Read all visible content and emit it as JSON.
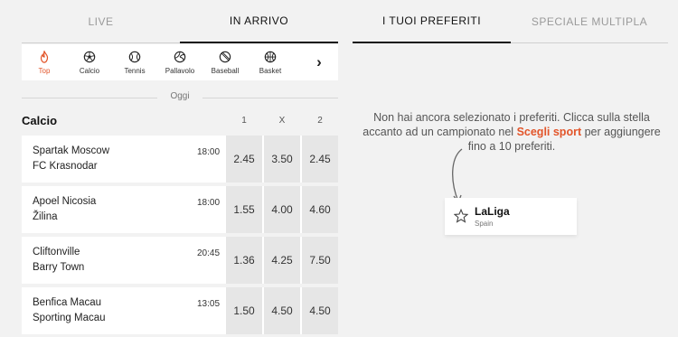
{
  "tabs": [
    {
      "label": "LIVE"
    },
    {
      "label": "IN ARRIVO"
    },
    {
      "label": "I TUOI PREFERITI"
    },
    {
      "label": "SPECIALE MULTIPLA"
    }
  ],
  "sports": [
    {
      "label": "Top",
      "icon": "fire-icon"
    },
    {
      "label": "Calcio",
      "icon": "soccer-ball-icon"
    },
    {
      "label": "Tennis",
      "icon": "tennis-ball-icon"
    },
    {
      "label": "Pallavolo",
      "icon": "volleyball-icon"
    },
    {
      "label": "Baseball",
      "icon": "baseball-icon"
    },
    {
      "label": "Basket",
      "icon": "basketball-icon"
    }
  ],
  "sports_next_icon": "›",
  "day_label": "Oggi",
  "league": {
    "title": "Calcio",
    "columns": [
      "1",
      "X",
      "2"
    ]
  },
  "matches": [
    {
      "home": "Spartak Moscow",
      "away": "FC Krasnodar",
      "time": "18:00",
      "odds": [
        "2.45",
        "3.50",
        "2.45"
      ]
    },
    {
      "home": "Apoel Nicosia",
      "away": "Žilina",
      "time": "18:00",
      "odds": [
        "1.55",
        "4.00",
        "4.60"
      ]
    },
    {
      "home": "Cliftonville",
      "away": "Barry Town",
      "time": "20:45",
      "odds": [
        "1.36",
        "4.25",
        "7.50"
      ]
    },
    {
      "home": "Benfica Macau",
      "away": "Sporting Macau",
      "time": "13:05",
      "odds": [
        "1.50",
        "4.50",
        "4.50"
      ]
    }
  ],
  "favorites": {
    "msg_before": "Non hai ancora selezionato i preferiti. Clicca sulla stella accanto ad un campionato nel ",
    "msg_link": "Scegli sport",
    "msg_after": " per aggiungere fino a 10 preferiti.",
    "example_name": "LaLiga",
    "example_country": "Spain"
  },
  "colors": {
    "accent": "#e2552a",
    "background": "#f2f2f2",
    "odds_cell": "#e6e6e6"
  }
}
